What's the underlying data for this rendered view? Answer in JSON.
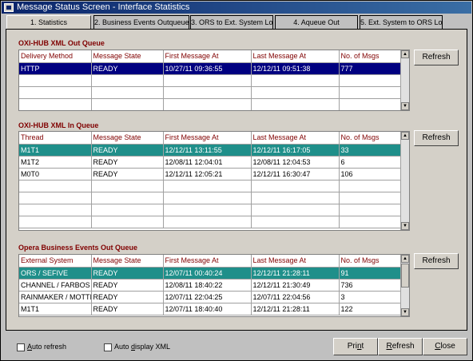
{
  "window": {
    "title": "Message Status Screen - Interface Statistics"
  },
  "tabs": [
    {
      "label": "1. Statistics",
      "active": true
    },
    {
      "label": "2. Business Events Outqueue",
      "active": false
    },
    {
      "label": "3. ORS to Ext. System Log",
      "active": false
    },
    {
      "label": "4. Aqueue Out",
      "active": false
    },
    {
      "label": "5. Ext. System to ORS Log",
      "active": false
    }
  ],
  "out_queue": {
    "title": "OXI-HUB XML Out Queue",
    "columns": [
      "Delivery Method",
      "Message State",
      "First Message At",
      "Last Message At",
      "No. of Msgs"
    ],
    "rows": [
      [
        "HTTP",
        "READY",
        "10/27/11 09:36:55",
        "12/12/11 09:51:38",
        "777"
      ]
    ],
    "refresh_label": "Refresh"
  },
  "in_queue": {
    "title": "OXI-HUB XML In Queue",
    "columns": [
      "Thread",
      "Message State",
      "First Message At",
      "Last Message At",
      "No. of Msgs"
    ],
    "rows": [
      [
        "M1T1",
        "READY",
        "12/12/11 13:11:55",
        "12/12/11 16:17:05",
        "33"
      ],
      [
        "M1T2",
        "READY",
        "12/08/11 12:04:01",
        "12/08/11 12:04:53",
        "6"
      ],
      [
        "M0T0",
        "READY",
        "12/12/11 12:05:21",
        "12/12/11 16:30:47",
        "106"
      ]
    ],
    "refresh_label": "Refresh"
  },
  "events_queue": {
    "title": "Opera Business Events Out Queue",
    "columns": [
      "External System",
      "Message State",
      "First Message At",
      "Last Message At",
      "No. of Msgs"
    ],
    "rows": [
      [
        "ORS / SEFIVE",
        "READY",
        "12/07/11 00:40:24",
        "12/12/11 21:28:11",
        "91"
      ],
      [
        "CHANNEL / FARBOS",
        "READY",
        "12/08/11 18:40:22",
        "12/12/11 21:30:49",
        "736"
      ],
      [
        "RAINMAKER / MOTTI",
        "READY",
        "12/07/11 22:04:25",
        "12/07/11 22:04:56",
        "3"
      ],
      [
        "M1T1",
        "READY",
        "12/07/11 18:40:40",
        "12/12/11 21:28:11",
        "122"
      ]
    ],
    "refresh_label": "Refresh"
  },
  "footer": {
    "auto_refresh": {
      "pre": "",
      "ul": "A",
      "post": "uto refresh"
    },
    "auto_display": {
      "pre": "Auto ",
      "ul": "d",
      "post": "isplay XML"
    },
    "print": {
      "pre": "Pri",
      "ul": "n",
      "post": "t"
    },
    "refresh": {
      "pre": "",
      "ul": "R",
      "post": "efresh"
    },
    "close": {
      "pre": "",
      "ul": "C",
      "post": "lose"
    }
  },
  "colors": {
    "title_bar": "#0a246a",
    "section_title": "#800000",
    "selected_blue": "#000080",
    "selected_teal": "#1f8f8a"
  }
}
